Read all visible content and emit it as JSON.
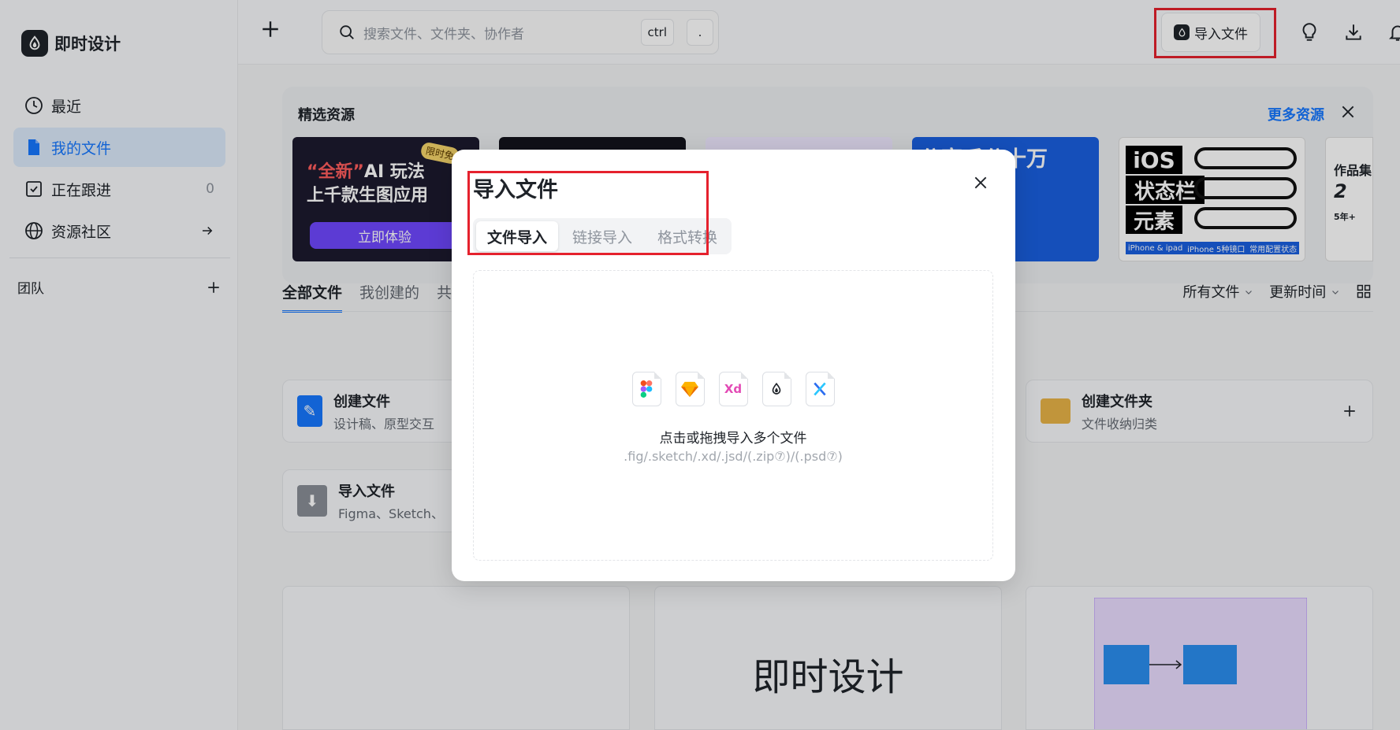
{
  "app": {
    "name": "即时设计"
  },
  "sidebar": {
    "items": [
      {
        "label": "最近",
        "icon": "clock-icon"
      },
      {
        "label": "我的文件",
        "icon": "file-icon",
        "active": true
      },
      {
        "label": "正在跟进",
        "icon": "follow-icon",
        "count": "0"
      },
      {
        "label": "资源社区",
        "icon": "globe-icon"
      }
    ],
    "team_label": "团队"
  },
  "topbar": {
    "search_placeholder": "搜索文件、文件夹、协作者",
    "shortcut_key1": "ctrl",
    "shortcut_key2": ".",
    "import_label": "导入文件"
  },
  "featured": {
    "title": "精选资源",
    "more_label": "更多资源",
    "card1": {
      "line1_prefix": "“全新”",
      "line1": "AI 玩法",
      "line2": "上千款生图应用",
      "button": "立即体验",
      "badge": "限时免"
    },
    "card4": {
      "text": "分享瓜分十万"
    },
    "card5": {
      "lines": [
        "iOS",
        "状态栏",
        "元素"
      ],
      "footer": [
        "iPhone & ipad",
        "iPhone 5种镜口",
        "常用配置状态"
      ]
    },
    "card6": {
      "line1": "作品集",
      "line2": "2",
      "line3": "5年+"
    }
  },
  "file_tabs": {
    "tabs": [
      "全部文件",
      "我创建的",
      "共"
    ],
    "filter_all": "所有文件",
    "filter_sort": "更新时间"
  },
  "quick": {
    "create_file": {
      "title": "创建文件",
      "subtitle": "设计稿、原型交互"
    },
    "create_folder": {
      "title": "创建文件夹",
      "subtitle": "文件收纳归类"
    },
    "import_file": {
      "title": "导入文件",
      "subtitle": "Figma、Sketch、"
    }
  },
  "files": {
    "card2_title": "即时设计"
  },
  "modal": {
    "title": "导入文件",
    "tabs": [
      "文件导入",
      "链接导入",
      "格式转换"
    ],
    "formats": [
      "figma-icon",
      "sketch-icon",
      "xd-icon",
      "jsd-icon",
      "axure-icon"
    ],
    "xd_label": "Xd",
    "drop_text": "点击或拖拽导入多个文件",
    "drop_hint": ".fig/.sketch/.xd/.jsd/(.zip⑦)/(.psd⑦)"
  },
  "colors": {
    "accent": "#1677ff",
    "highlight": "#e5212d",
    "active_bg": "#dbeafb"
  }
}
